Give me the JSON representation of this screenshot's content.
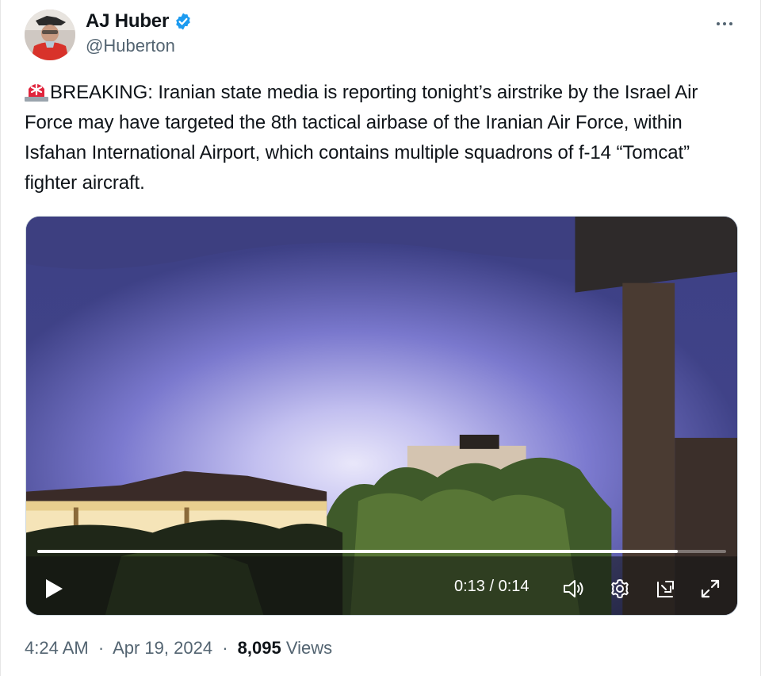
{
  "author": {
    "display_name": "AJ Huber",
    "handle": "@Huberton",
    "verified": true,
    "avatar_icon": "avatar-icon"
  },
  "tweet": {
    "text": "BREAKING: Iranian state media is reporting tonight’s airstrike by the Israel Air Force may have targeted the 8th tactical airbase of the Iranian Air Force, within Isfahan International Airport, which contains multiple squadrons of f-14 “Tomcat” fighter aircraft.",
    "prefix_emoji": "siren-icon"
  },
  "video": {
    "time_display": "0:13 / 0:14",
    "progress_fraction": 0.93,
    "controls": [
      "play-icon",
      "volume-icon",
      "gear-icon",
      "picture-in-picture-icon",
      "fullscreen-icon"
    ]
  },
  "footer": {
    "time": "4:24 AM",
    "date": "Apr 19, 2024",
    "views_count": "8,095",
    "views_label": "Views",
    "separator": "·"
  },
  "colors": {
    "verified_blue": "#1d9bf0",
    "secondary_text": "#536471",
    "primary_text": "#0f1419",
    "siren_red": "#e0243c"
  }
}
